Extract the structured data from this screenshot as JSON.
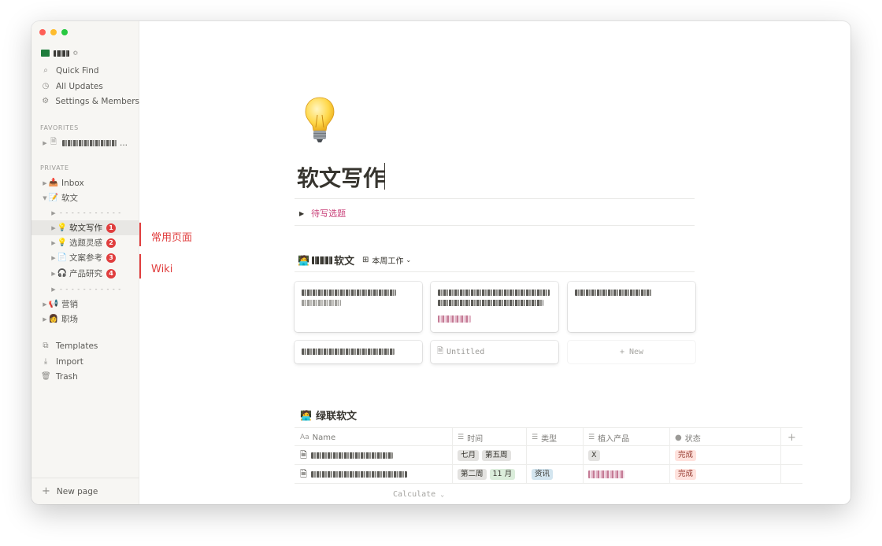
{
  "sidebar": {
    "workspace_chevron": "≎",
    "quick_find": "Quick Find",
    "all_updates": "All Updates",
    "settings": "Settings & Members",
    "favorites_label": "FAVORITES",
    "favorites_ellipsis": "...",
    "private_label": "PRIVATE",
    "inbox": "Inbox",
    "ruanwen": "软文",
    "dashes": "- - - - - - - - - - -",
    "items": [
      {
        "label": "软文写作",
        "badge": "1"
      },
      {
        "label": "选题灵感",
        "badge": "2"
      },
      {
        "label": "文案参考",
        "badge": "3"
      },
      {
        "label": "产品研究",
        "badge": "4"
      }
    ],
    "marketing": "营销",
    "workplace": "职场",
    "templates": "Templates",
    "import": "Import",
    "trash": "Trash",
    "new_page": "New page"
  },
  "annotations": {
    "common_pages": "常用页面",
    "wiki": "Wiki"
  },
  "page": {
    "title": "软文写作",
    "toggle_label": "待写选题",
    "db1": {
      "title_suffix": "软文",
      "view_label": "本周工作",
      "untitled": "Untitled",
      "new_label": "+ New"
    },
    "db2": {
      "title": "绿联软文",
      "columns": [
        "Name",
        "时间",
        "类型",
        "植入产品",
        "状态"
      ],
      "rows": [
        {
          "time_tags": [
            "七月",
            "第五周"
          ],
          "type_tags": [],
          "product_tag": "X",
          "status": "完成"
        },
        {
          "time_tags": [
            "第二周",
            "11 月"
          ],
          "type_tags": [
            "资讯"
          ],
          "product_tag": "",
          "status": "完成"
        }
      ],
      "add_col": "+",
      "calculate": "Calculate"
    }
  },
  "colors": {
    "accent_red": "#e03e3e",
    "toggle_pink": "#c9427a",
    "tag_gray": "#e3e2e0",
    "tag_green": "#dbeddb",
    "tag_blue": "#d3e5ef",
    "tag_red": "#ffe2dd"
  }
}
